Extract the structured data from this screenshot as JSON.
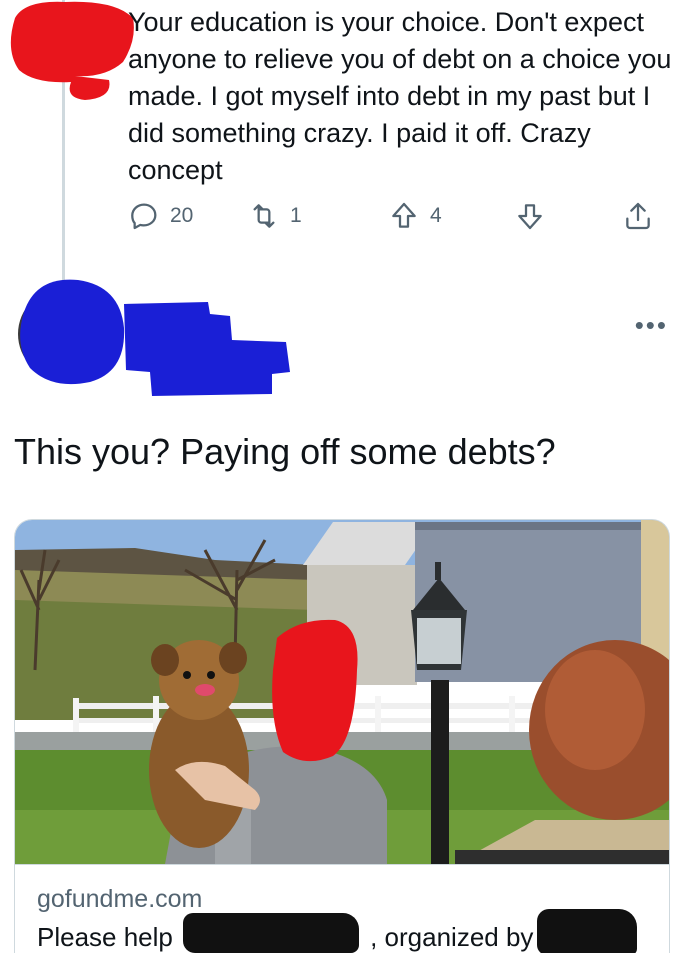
{
  "tweet": {
    "text": "Your education is your choice. Don't expect anyone to relieve you of debt on a choice you made. I got myself into debt in my past but I did something crazy. I paid it off. Crazy concept",
    "actions": {
      "replies": "20",
      "retweets": "1",
      "upvotes": "4"
    }
  },
  "reply": {
    "handle_prefix": "@",
    "text": "This you? Paying off some debts?"
  },
  "card": {
    "domain": "gofundme.com",
    "title_start": "Please help ",
    "title_mid": ", organized by "
  },
  "colors": {
    "text": "#0f1419",
    "secondary": "#536471",
    "border": "#cfd9de",
    "redact_red": "#e8151c",
    "redact_blue": "#1a1fd6"
  }
}
